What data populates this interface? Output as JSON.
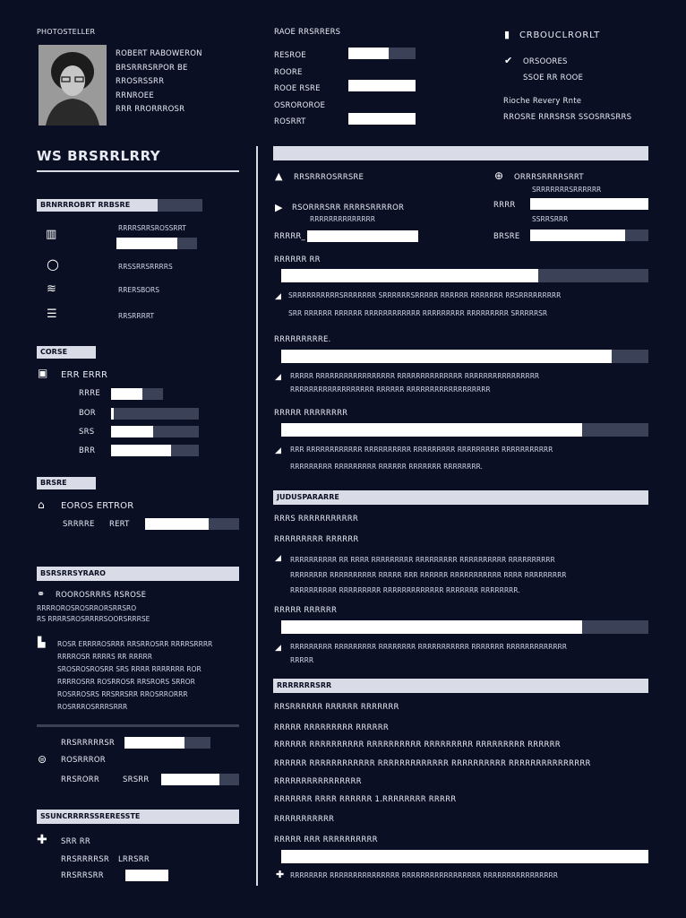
{
  "header": {
    "name_label": "PHOTOSTELLER",
    "contact_lines": [
      "ROBERT RABOWERON",
      "BRSRRRSRPOR BE",
      "RROSRSSRR",
      "RRNROEE",
      "RRR RRORRROSR"
    ],
    "mid_lines": [
      "RAOE RRSRRERS",
      "RESROE",
      "ROORE",
      "ROOE RSRE",
      "OSROROROE",
      "ROSRRT"
    ],
    "mid_bars": [
      0.6,
      0,
      1,
      0,
      1
    ],
    "right_title": "CRBOUCLRORLT",
    "right_lines": [
      "ORSOORES",
      "SSOE RR ROOE",
      "Rioche Revery Rnte",
      "RROSRE RRRSRSR SSOSRRSRRS"
    ]
  },
  "left": {
    "title": "WS BRSRRLRRY",
    "section1": {
      "label": "BRNRRROBRT RRBSRE",
      "items": [
        {
          "icon": "chart-icon",
          "text": "RRRRSRRSROSSRRT",
          "bar": 0.75
        },
        {
          "icon": "circle-icon",
          "text": "RRSSRRSRRRRS",
          "bar": 0
        },
        {
          "icon": "stack-icon",
          "text": "RRERSBORS",
          "bar": 0
        },
        {
          "icon": "list-icon",
          "text": "RRSRRRRT",
          "bar": 0
        }
      ]
    },
    "section2": {
      "label": "CORSE",
      "heading": "ERR ERRR",
      "rows": [
        {
          "label": "RRRE",
          "value": 0.6
        },
        {
          "label": "BOR",
          "value": 0.03
        },
        {
          "label": "SRS",
          "value": 0.48
        },
        {
          "label": "BRR",
          "value": 0.68
        }
      ]
    },
    "section3": {
      "label": "BRSRE",
      "heading": "EOROS ERTROR",
      "row_label": "SRRRRE",
      "row_label2": "RERT",
      "value": 0.68
    },
    "section4": {
      "label": "BSRSRRSYRARO",
      "line1": "ROOROSRRRS RSROSE",
      "line2": "RRRROROSROSRRORSRRSRO",
      "line3": "RS RRRRSROSRRRRSOORSRRRSE",
      "para": [
        "ROSR ERRRROSRRR RRSRROSRR RRRRSRRRR",
        "RRRROSR RRRRS RR RRRRR",
        "SROSROSROSRR SRS RRRR RRRRRRR ROR",
        "RRRROSRR ROSRROSR RRSRORS SRROR",
        "ROSRROSRS RRSRRSRR RROSRRORRR",
        "ROSRRROSRRRSRRR"
      ],
      "rows": [
        {
          "label": "RRSRRRRRSR",
          "value": 0.7
        },
        {
          "label": "ROSRRROR",
          "value": 0
        },
        {
          "label": "RRSRORR",
          "label2": "SRSRR",
          "value": 0.75
        }
      ]
    },
    "section5": {
      "label": "SSUNCRRRRSSRERESSTE",
      "line1": "SRR RR",
      "rows": [
        {
          "label": "RRSRRRRSR",
          "label2": "LRRSRR",
          "value": 0
        },
        {
          "label": "RRSRRSRR",
          "value": 0.7
        }
      ]
    }
  },
  "right": {
    "block1": {
      "left_heading": "RRSRRROSRRSRE",
      "left_lines": [
        "RSORRRSRR RRRRSRRRROR",
        "RRRRRRRRRRRRRR"
      ],
      "left_row": "RRRRR_",
      "right_heading": "ORRRSRRRRSRRT",
      "right_lines": [
        "SRRRRRRRSRRRRRR",
        "SSRRSRRR"
      ],
      "right_row1": "RRRR",
      "right_row2": "BRSRE",
      "skills": [
        {
          "label": "RRRRRR RR",
          "value": 0.7,
          "note": [
            "SRRRRRRRRRRSRRRRRRR SRRRRRRSRRRRR RRRRRR RRRRRRR RRSRRRRRRRRR",
            "SRR RRRRRR RRRRRR RRRRRRRRRRRR RRRRRRRRR RRRRRRRRR SRRRRRSR"
          ]
        },
        {
          "label": "RRRRRRRRRE.",
          "value": 0.9,
          "note": [
            "RRRRR RRRRRRRRRRRRRRRRR RRRRRRRRRRRRRR RRRRRRRRRRRRRRRR",
            "RRRRRRRRRRRRRRRRRR RRRRRR RRRRRRRRRRRRRRRRRR"
          ]
        },
        {
          "label": "RRRRR RRRRRRRR",
          "value": 0.82,
          "note": [
            "RRR RRRRRRRRRRRR RRRRRRRRRR RRRRRRRRR RRRRRRRRR RRRRRRRRRRR",
            "RRRRRRRRR RRRRRRRRR RRRRRR RRRRRRR RRRRRRRR."
          ]
        }
      ]
    },
    "block2": {
      "label": "JUDUSPARARRE",
      "line1": "RRRS RRRRRRRRRRR",
      "line2": "RRRRRRRRR RRRRRR",
      "para": [
        "RRRRRRRRRR RR RRRR RRRRRRRRR RRRRRRRRR RRRRRRRRRR RRRRRRRRRR",
        "RRRRRRRR RRRRRRRRRR RRRRR RRR RRRRRR RRRRRRRRRRR RRRR RRRRRRRRR",
        "RRRRRRRRRR RRRRRRRRR RRRRRRRRRRRRR RRRRRRR RRRRRRRR."
      ],
      "skill_label": "RRRRR RRRRRR",
      "skill_value": 0.82,
      "note": [
        "RRRRRRRRR RRRRRRRRR RRRRRRRR RRRRRRRRRRR RRRRRRR RRRRRRRRRRRRR",
        "RRRRR"
      ]
    },
    "block3": {
      "label": "RRRRRRRSRR",
      "lines": [
        "RRSRRRRRR RRRRRR RRRRRRR",
        "RRRRR RRRRRRRRR RRRRRR",
        "RRRRRR RRRRRRRRRR RRRRRRRRRR RRRRRRRRR RRRRRRRRR RRRRRR",
        "RRRRRR RRRRRRRRRRRR RRRRRRRRRRRRR RRRRRRRRRR RRRRRRRRRRRRRRR",
        "RRRRRRRRRRRRRRRR",
        "RRRRRRR RRRR RRRRRR 1.RRRRRRRR RRRRR",
        "RRRRRRRRRRR"
      ],
      "skill_label": "RRRRR RRR RRRRRRRRRR",
      "skill_value": 1,
      "note": "RRRRRRRR RRRRRRRRRRRRRRR RRRRRRRRRRRRRRRRR RRRRRRRRRRRRRRRR"
    }
  }
}
